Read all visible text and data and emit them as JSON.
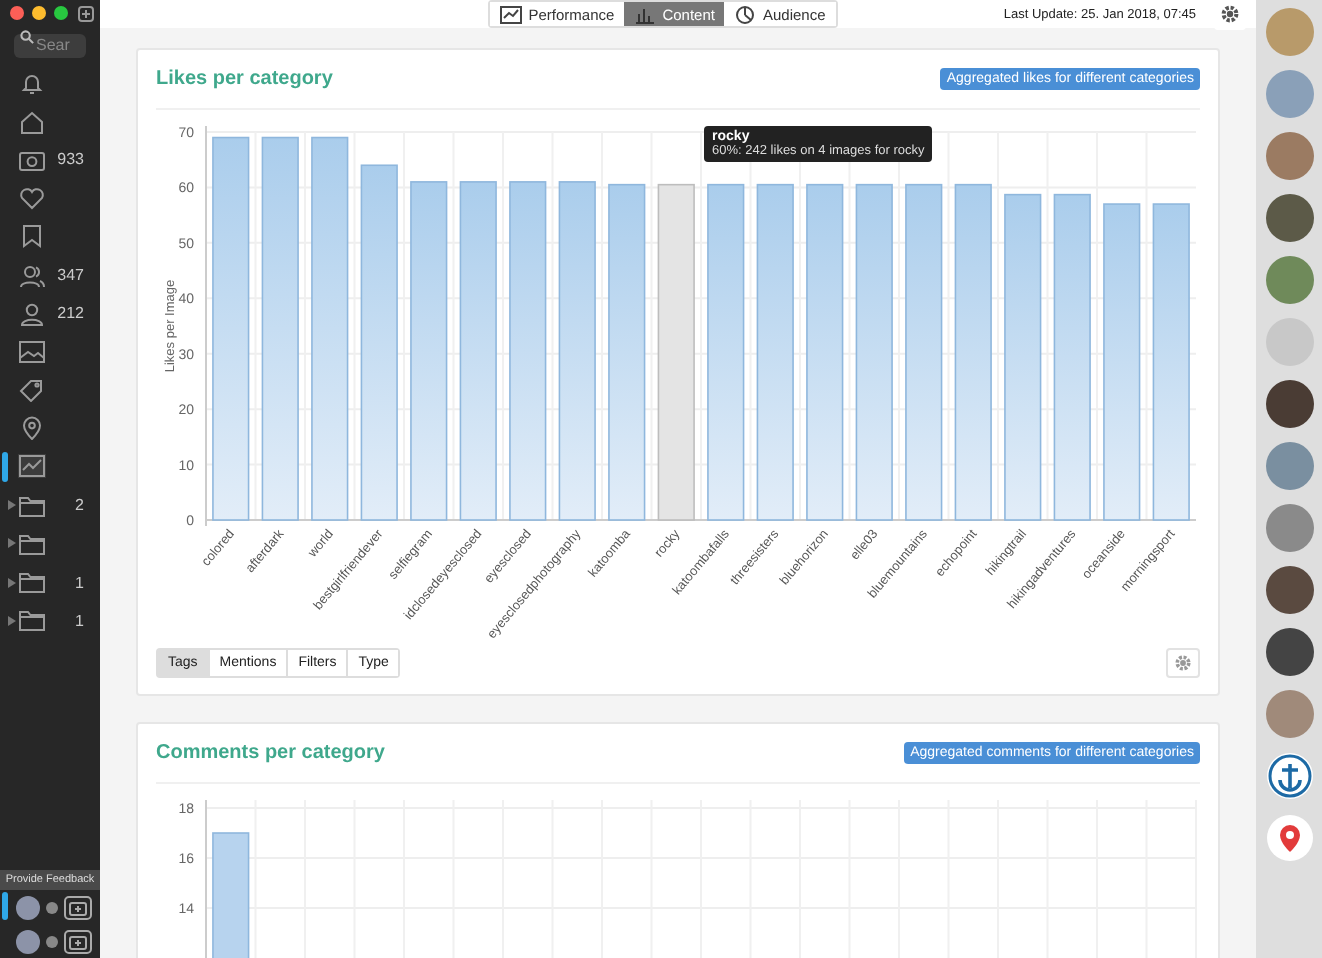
{
  "sidebar": {
    "search": {
      "placeholder": "Sear"
    },
    "items": [
      {
        "kind": "bell",
        "selected": false
      },
      {
        "kind": "home",
        "selected": false
      },
      {
        "kind": "camera",
        "count": "933",
        "selected": false
      },
      {
        "kind": "heart",
        "selected": false
      },
      {
        "kind": "bookmark",
        "selected": false
      },
      {
        "kind": "users",
        "count": "347",
        "selected": false
      },
      {
        "kind": "user",
        "count": "212",
        "selected": false
      },
      {
        "kind": "image",
        "selected": false
      },
      {
        "kind": "tag",
        "selected": false
      },
      {
        "kind": "pin",
        "selected": false
      },
      {
        "kind": "chart",
        "selected": true
      },
      {
        "kind": "folder",
        "count": "2",
        "selected": false
      },
      {
        "kind": "folder",
        "selected": false
      },
      {
        "kind": "folder",
        "count": "1",
        "selected": false
      },
      {
        "kind": "folder",
        "count": "1",
        "selected": false
      }
    ],
    "feedback": "Provide Feedback",
    "accounts": [
      {
        "selected": true
      },
      {
        "selected": false
      }
    ]
  },
  "topbar": {
    "tabs": [
      {
        "kind": "line",
        "label": "Performance",
        "selected": false
      },
      {
        "kind": "bar",
        "label": "Content",
        "selected": true
      },
      {
        "kind": "pie",
        "label": "Audience",
        "selected": false
      }
    ],
    "last_update": "Last Update: 25. Jan 2018, 07:45"
  },
  "cards": [
    {
      "title": "Likes per category",
      "badge": "Aggregated likes for different categories",
      "chart_data": {
        "type": "bar",
        "ylabel": "Likes per Image",
        "categories": [
          "colored",
          "afterdark",
          "world",
          "bestgirlfriendever",
          "selfiegram",
          "idclosedeyesclosed",
          "eyesclosed",
          "eyesclosedphotography",
          "katoomba",
          "rocky",
          "katoombafalls",
          "threesisters",
          "bluehorizon",
          "elle03",
          "bluemountains",
          "echopoint",
          "hikingtrail",
          "hikingadventures",
          "oceanside",
          "morningsport"
        ],
        "values": [
          69,
          69,
          69,
          64,
          61,
          61,
          61,
          61,
          60.5,
          60.5,
          60.5,
          60.5,
          60.5,
          60.5,
          60.5,
          60.5,
          58.7,
          58.7,
          57,
          57
        ],
        "ylim": [
          0,
          70
        ],
        "yticks": [
          0,
          10,
          20,
          30,
          40,
          50,
          60,
          70
        ],
        "grid": true
      },
      "bars": [
        {
          "selected": false
        },
        {
          "selected": false
        },
        {
          "selected": false
        },
        {
          "selected": false
        },
        {
          "selected": false
        },
        {
          "selected": false
        },
        {
          "selected": false
        },
        {
          "selected": false
        },
        {
          "selected": false
        },
        {
          "selected": true
        },
        {
          "selected": false
        },
        {
          "selected": false
        },
        {
          "selected": false
        },
        {
          "selected": false
        },
        {
          "selected": false
        },
        {
          "selected": false
        },
        {
          "selected": false
        },
        {
          "selected": false
        },
        {
          "selected": false
        },
        {
          "selected": false
        }
      ],
      "tooltip": {
        "title": "rocky",
        "text": "60%: 242 likes on 4 images for rocky"
      },
      "filters": [
        {
          "label": "Tags",
          "selected": true
        },
        {
          "label": "Mentions",
          "selected": false
        },
        {
          "label": "Filters",
          "selected": false
        },
        {
          "label": "Type",
          "selected": false
        }
      ]
    },
    {
      "title": "Comments per category",
      "badge": "Aggregated comments for different categories",
      "chart_data": {
        "type": "bar",
        "values": [
          17
        ],
        "ylim": [
          0,
          18
        ],
        "yticks": [
          14,
          16,
          18
        ],
        "grid": true
      }
    }
  ],
  "avatars": [
    {
      "kind": "photo"
    },
    {
      "kind": "photo"
    },
    {
      "kind": "photo"
    },
    {
      "kind": "photo"
    },
    {
      "kind": "photo"
    },
    {
      "kind": "photo"
    },
    {
      "kind": "photo"
    },
    {
      "kind": "photo"
    },
    {
      "kind": "photo"
    },
    {
      "kind": "photo"
    },
    {
      "kind": "photo"
    },
    {
      "kind": "photo"
    },
    {
      "kind": "anchor"
    },
    {
      "kind": "pin"
    }
  ]
}
